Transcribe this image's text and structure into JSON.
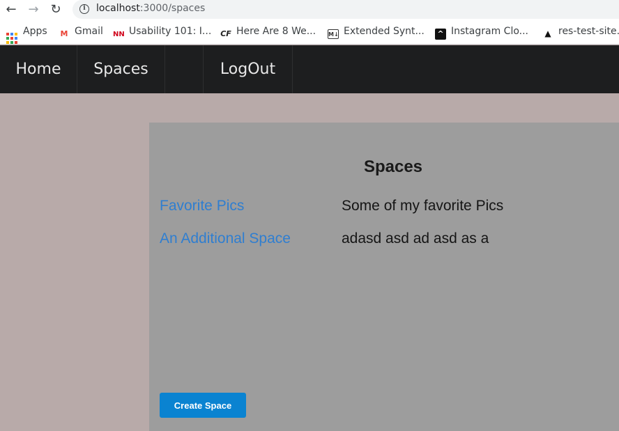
{
  "browser": {
    "url_host": "localhost",
    "url_path": ":3000/spaces",
    "bookmarks": [
      {
        "label": "Apps",
        "icon": "apps-grid-icon"
      },
      {
        "label": "Gmail",
        "icon": "gmail-icon"
      },
      {
        "label": "Usability 101: I...",
        "icon": "nn-icon"
      },
      {
        "label": "Here Are 8 We...",
        "icon": "cf-icon"
      },
      {
        "label": "Extended Synt...",
        "icon": "markdown-icon"
      },
      {
        "label": "Instagram Clo...",
        "icon": "instagram-clone-icon"
      },
      {
        "label": "res-test-site.",
        "icon": "triangle-icon"
      }
    ]
  },
  "navbar": {
    "home": "Home",
    "spaces": "Spaces",
    "logout": "LogOut"
  },
  "main": {
    "title": "Spaces",
    "spaces": [
      {
        "name": "Favorite Pics",
        "description": "Some of my favorite Pics"
      },
      {
        "name": "An Additional Space",
        "description": "adasd asd ad asd as a"
      }
    ],
    "create_button": "Create Space"
  },
  "colors": {
    "page_bg": "#b8aaa9",
    "navbar_bg": "#1d1e1f",
    "panel_bg": "#9d9d9d",
    "link": "#2f7ed0",
    "button": "#0a83d1"
  }
}
